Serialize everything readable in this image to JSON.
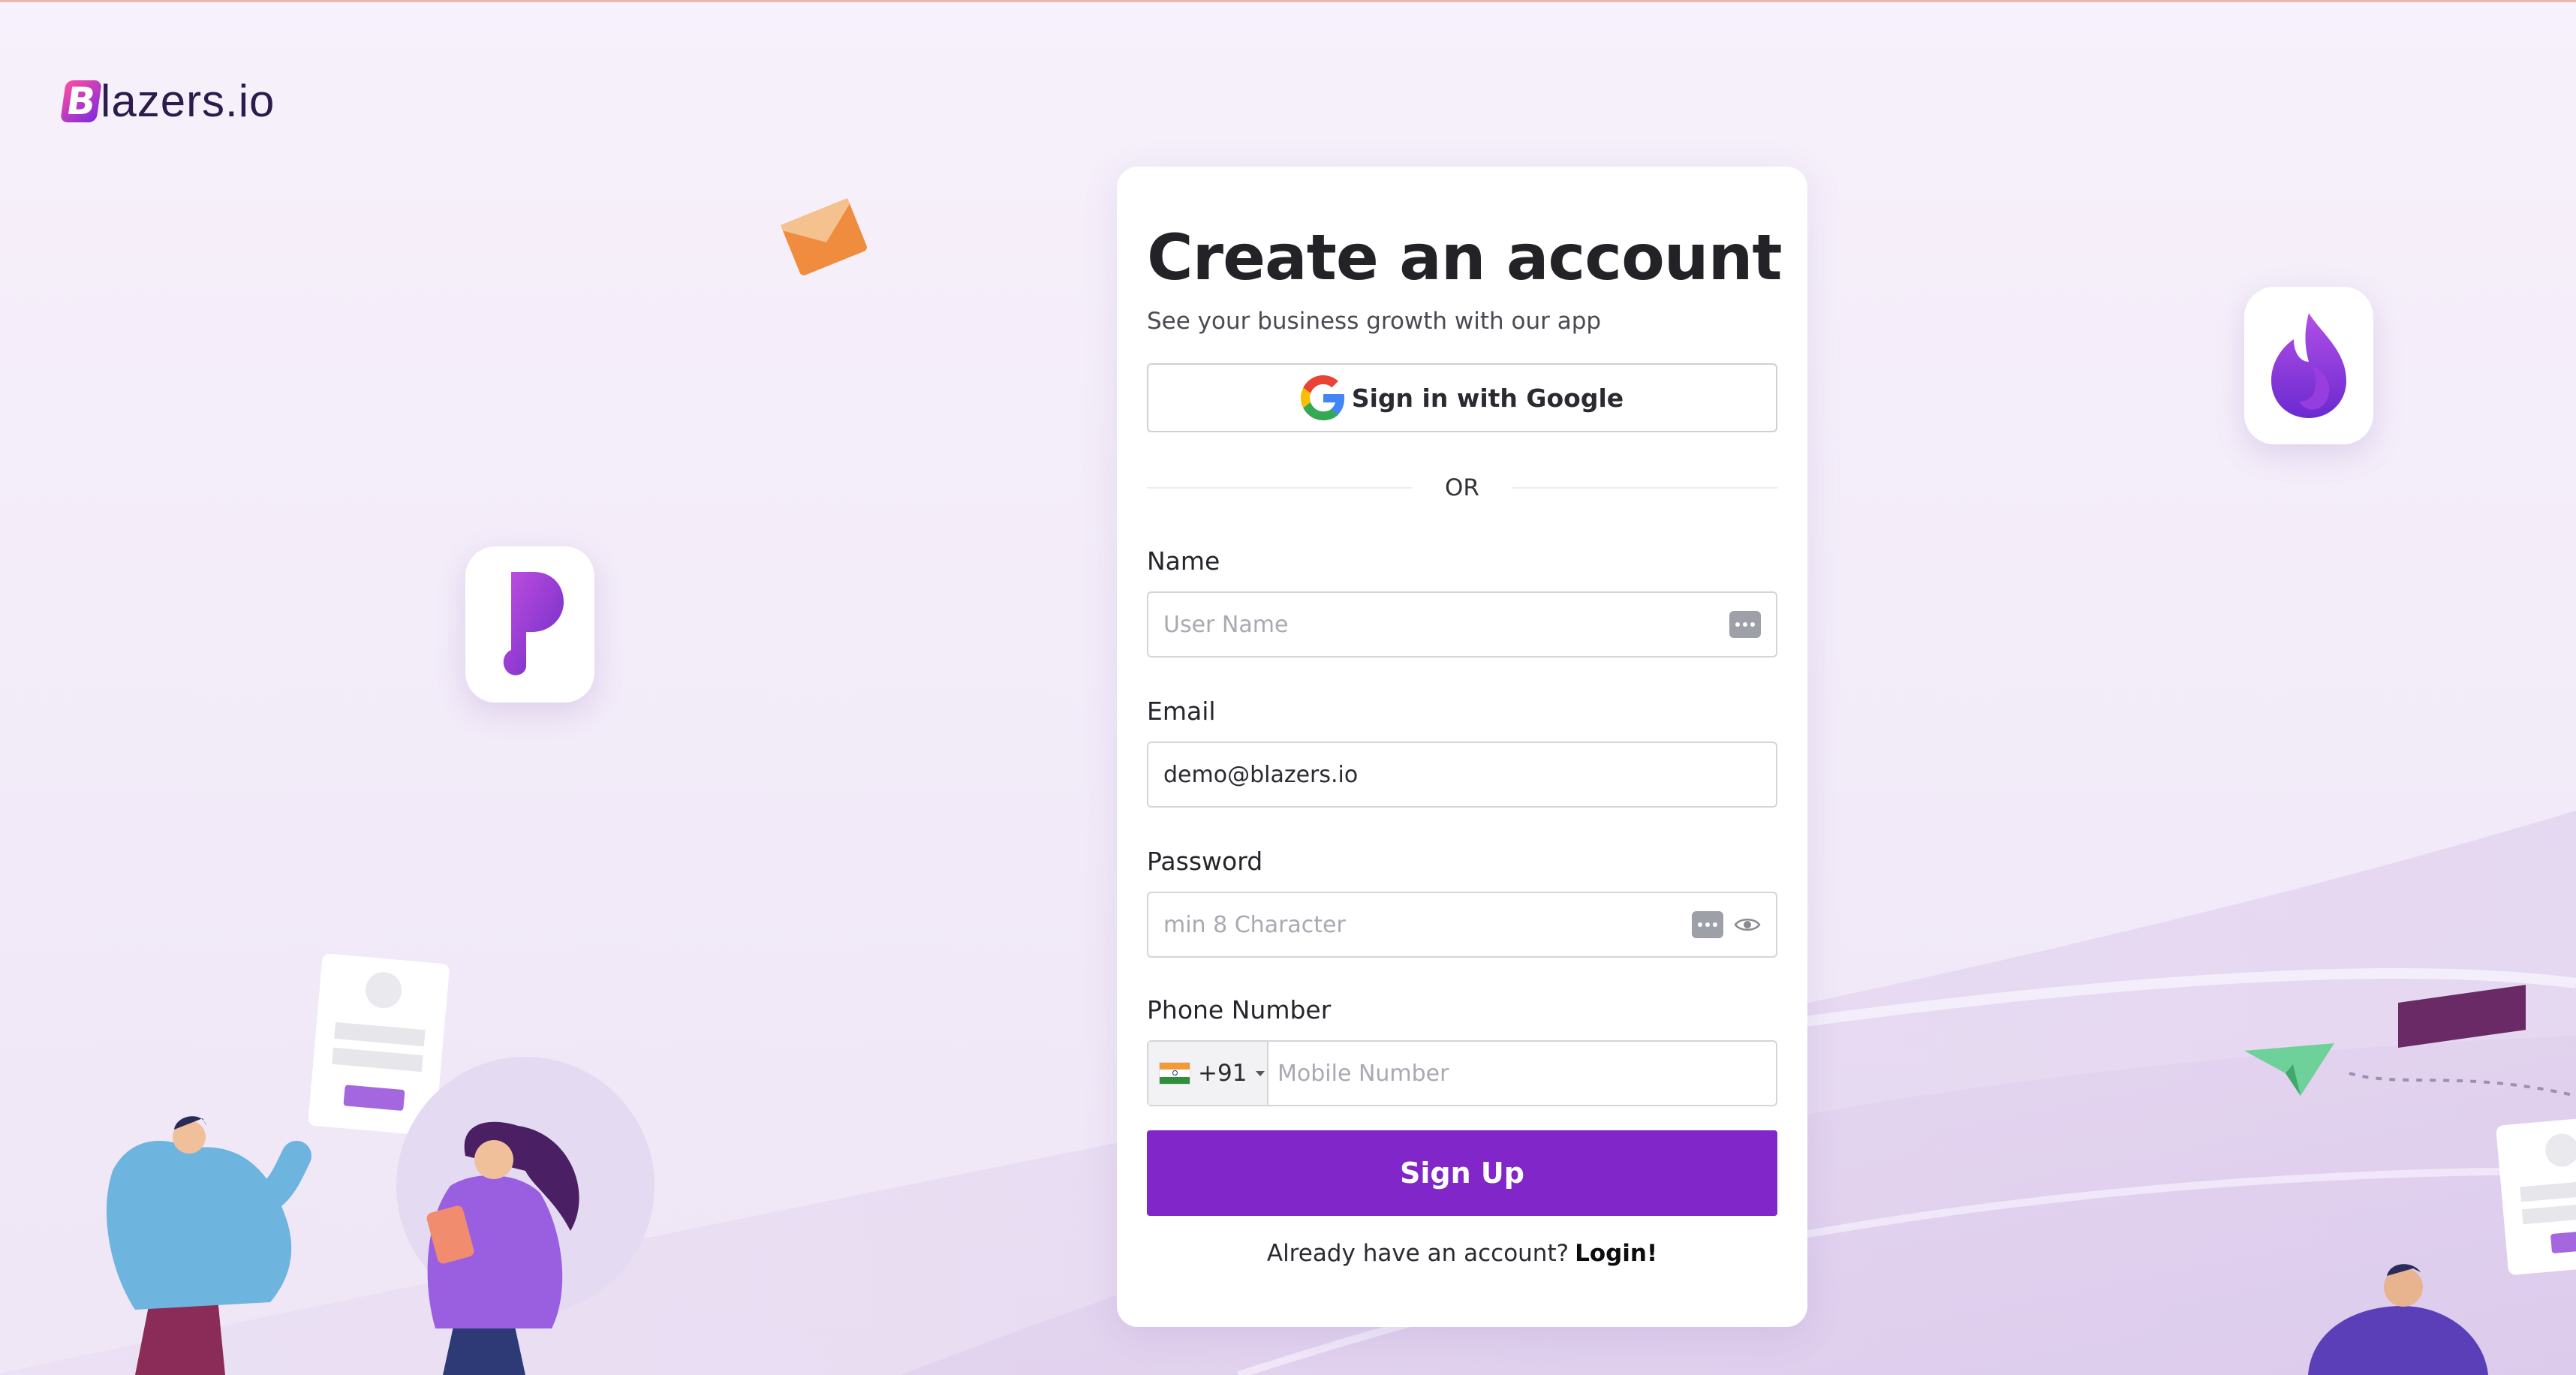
{
  "brand": {
    "logo_letter": "B",
    "logo_text": "lazers.io"
  },
  "form": {
    "title": "Create an account",
    "subtitle": "See your business growth with our app",
    "google_button": "Sign in with Google",
    "divider": "OR",
    "name": {
      "label": "Name",
      "placeholder": "User Name",
      "value": ""
    },
    "email": {
      "label": "Email",
      "placeholder": "",
      "value": "demo@blazers.io"
    },
    "password": {
      "label": "Password",
      "placeholder": "min 8 Character",
      "value": ""
    },
    "phone": {
      "label": "Phone Number",
      "country_code": "+91",
      "placeholder": "Mobile Number",
      "value": ""
    },
    "submit": "Sign Up",
    "footer_prompt": "Already have an account?",
    "footer_link": "Login!"
  },
  "icons": [
    "google-icon",
    "password-manager-icon",
    "eye-icon",
    "india-flag-icon",
    "chevron-down-icon"
  ],
  "colors": {
    "primary": "#8126c8",
    "background": "#f5eefa",
    "card": "#ffffff",
    "brand_gradient": [
      "#ff4fa0",
      "#7b2ae0"
    ]
  }
}
